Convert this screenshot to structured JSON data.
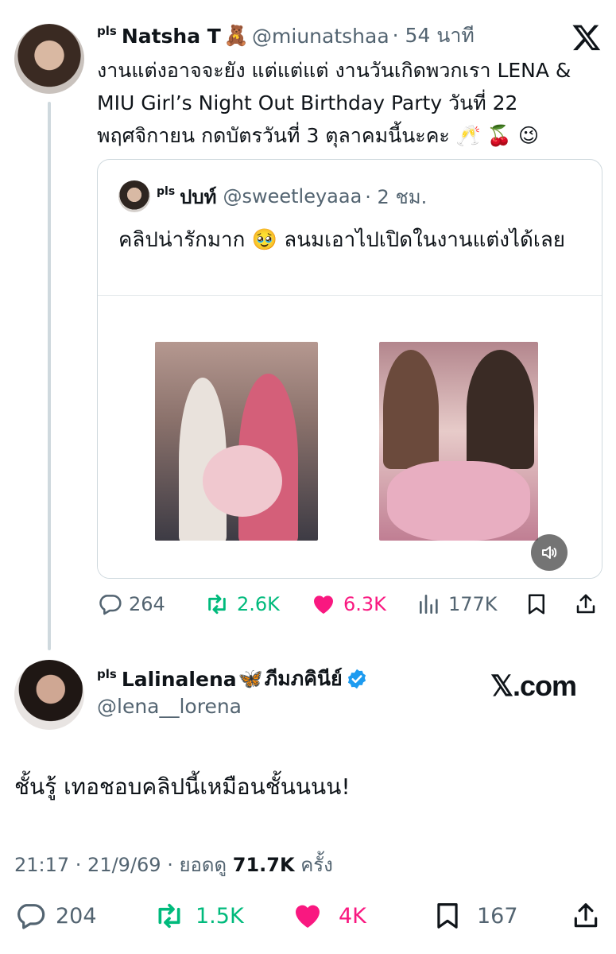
{
  "tweet": {
    "author_prefix": "pls",
    "author_name": "Natsha T",
    "author_emoji": "🧸",
    "handle": "@miunatshaa",
    "time": "· 54 นาที",
    "body": "งานแต่งอาจจะยัง แต่แต่แต่ งานวันเกิดพวกเรา LENA & MIU Girl’s Night Out Birthday Party วันที่ 22 พฤศจิกายน กดบัตรวันที่ 3 ตุลาคมนี้นะคะ 🥂 🍒 😉",
    "quote": {
      "author_prefix": "pls",
      "author_name": "ปบท์",
      "handle": "@sweetleyaaa",
      "time": "· 2 ชม.",
      "body": "คลิปน่ารักมาก 🥹 ลนมเอาไปเปิดในงานแต่งได้เลย"
    },
    "stats": {
      "replies": "264",
      "reposts": "2.6K",
      "likes": "6.3K",
      "views": "177K"
    }
  },
  "reply": {
    "author_prefix": "pls",
    "author_name": "Lalinalena",
    "author_emoji": "🦋",
    "author_name_th": "ภีมภคินีย์",
    "handle": "@lena__lorena",
    "brand": "𝕏.com",
    "body": "ชั้นรู้ เทอชอบคลิปนี้เหมือนชั้นนนน!",
    "meta_time": "21:17 · 21/9/69 · ยอดดู",
    "meta_views": "71.7K",
    "meta_suffix": "ครั้ง",
    "stats": {
      "replies": "204",
      "reposts": "1.5K",
      "likes": "4K",
      "bookmarks": "167"
    }
  },
  "colors": {
    "repost": "#00ba7c",
    "like": "#f91880",
    "verified": "#1d9bf0",
    "secondary": "#536471"
  }
}
